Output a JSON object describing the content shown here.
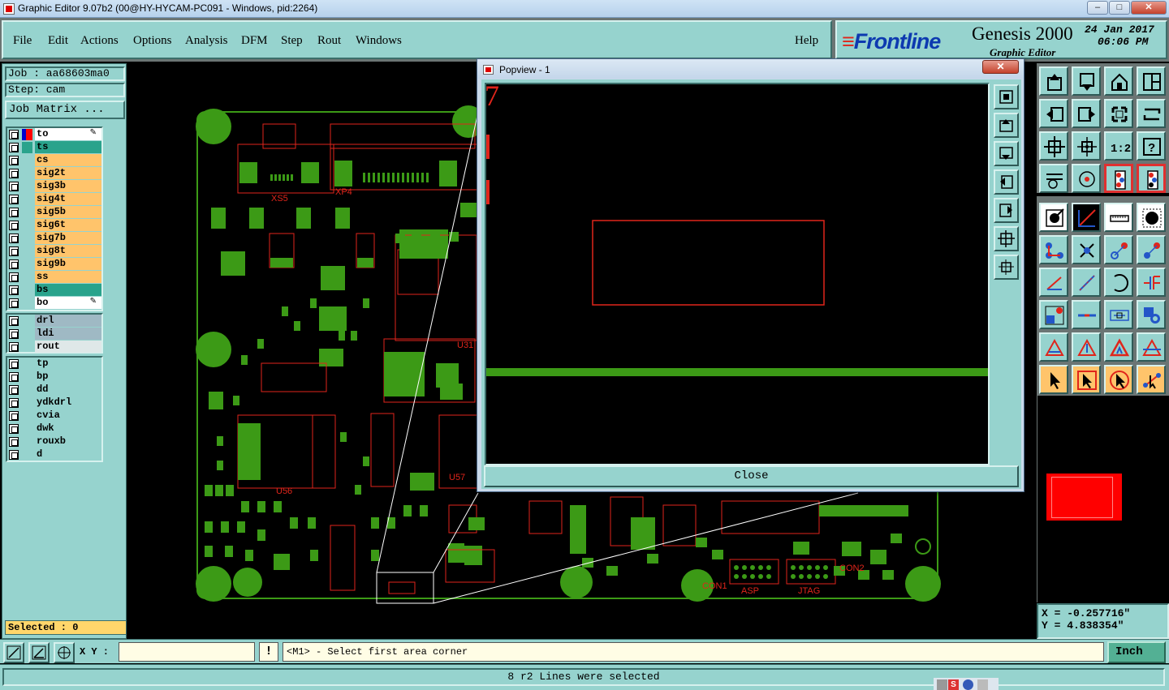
{
  "window": {
    "title": "Graphic Editor 9.07b2 (00@HY-HYCAM-PC091 - Windows, pid:2264)",
    "minimize": "‒",
    "maximize": "□",
    "close": "✕"
  },
  "menu": {
    "items": [
      "File",
      "Edit",
      "Actions",
      "Options",
      "Analysis",
      "DFM",
      "Step",
      "Rout",
      "Windows"
    ],
    "help": "Help"
  },
  "brand": {
    "logo": "Frontline",
    "product": "Genesis 2000",
    "subtitle": "Graphic Editor",
    "date": "24 Jan 2017",
    "time": "06:06 PM"
  },
  "job": {
    "job_label": "Job : aa68603ma0",
    "step_label": "Step: cam",
    "matrix_button": "Job Matrix ..."
  },
  "layers": {
    "group1": [
      {
        "name": "to",
        "color": "#ffffff",
        "flag": "#ff0000",
        "flag2": "#0000cc",
        "pen": true
      },
      {
        "name": "ts",
        "color": "#2aa38c",
        "flag": "#2aa38c"
      },
      {
        "name": "cs",
        "color": "#ffc46b"
      },
      {
        "name": "sig2t",
        "color": "#ffc46b"
      },
      {
        "name": "sig3b",
        "color": "#ffc46b"
      },
      {
        "name": "sig4t",
        "color": "#ffc46b"
      },
      {
        "name": "sig5b",
        "color": "#ffc46b"
      },
      {
        "name": "sig6t",
        "color": "#ffc46b"
      },
      {
        "name": "sig7b",
        "color": "#ffc46b"
      },
      {
        "name": "sig8t",
        "color": "#ffc46b"
      },
      {
        "name": "sig9b",
        "color": "#ffc46b"
      },
      {
        "name": "ss",
        "color": "#ffc46b"
      },
      {
        "name": "bs",
        "color": "#2aa38c"
      },
      {
        "name": "bo",
        "color": "#ffffff",
        "pen": true
      }
    ],
    "group2": [
      {
        "name": "drl",
        "color": "#9fb9c4"
      },
      {
        "name": "ldi",
        "color": "#9fb9c4"
      },
      {
        "name": "rout",
        "color": "#dfe8e8"
      }
    ],
    "group3": [
      {
        "name": "tp",
        "color": "#96d3ce"
      },
      {
        "name": "bp",
        "color": "#96d3ce"
      },
      {
        "name": "dd",
        "color": "#96d3ce"
      },
      {
        "name": "ydkdrl",
        "color": "#96d3ce"
      },
      {
        "name": "cvia",
        "color": "#96d3ce"
      },
      {
        "name": "dwk",
        "color": "#96d3ce"
      },
      {
        "name": "rouxb",
        "color": "#96d3ce"
      },
      {
        "name": "d",
        "color": "#96d3ce"
      }
    ]
  },
  "selected": "Selected : 0",
  "board": {
    "labels": [
      "XS5",
      "XP4",
      "U31",
      "U56",
      "U57",
      "ASP",
      "JTAG",
      "CON1",
      "CON2"
    ],
    "accent_green": "#3c9a16",
    "accent_red": "#e0251b"
  },
  "popview": {
    "title": "Popview - 1",
    "close_x": "✕",
    "close_button": "Close",
    "stray_glyph": "7"
  },
  "coords": {
    "x": "X = -0.257716\"",
    "y": "Y = 4.838354\""
  },
  "bottom": {
    "xy_label": "X Y :",
    "xy_value": "",
    "bang": "!",
    "prompt": "<M1> - Select first area corner",
    "units": "Inch"
  },
  "status": "8 r2 Lines were selected",
  "tools": [
    "zoom-home-icon",
    "zoom-bottom-icon",
    "home-grid-icon",
    "split-view-icon",
    "pan-left-icon",
    "pan-right-icon",
    "zoom-fit-icon",
    "toggle-icon",
    "zoom-in-icon",
    "zoom-out-icon",
    "ratio-1-2-icon",
    "help-icon",
    "measure-tool-icon",
    "snap-target-icon",
    "layer-stack-icon",
    "layer-stack-alt-icon",
    "select-point-icon",
    "draw-color-icon",
    "ruler-icon",
    "select-round-icon",
    "move-nodes-icon",
    "cross-icon",
    "line-pad-icon",
    "line-pad-alt-icon",
    "draw-line-icon",
    "angle-line-icon",
    "arc-icon",
    "transform-icon",
    "copy-pad-icon",
    "cut-line-icon",
    "dimension-icon",
    "group-icon",
    "triangle-measure-icon",
    "triangle-pad-icon",
    "triangle-up-icon",
    "triangle-align-icon",
    "pointer-icon",
    "pointer-box-icon",
    "pointer-round-icon",
    "pointer-node-icon"
  ]
}
